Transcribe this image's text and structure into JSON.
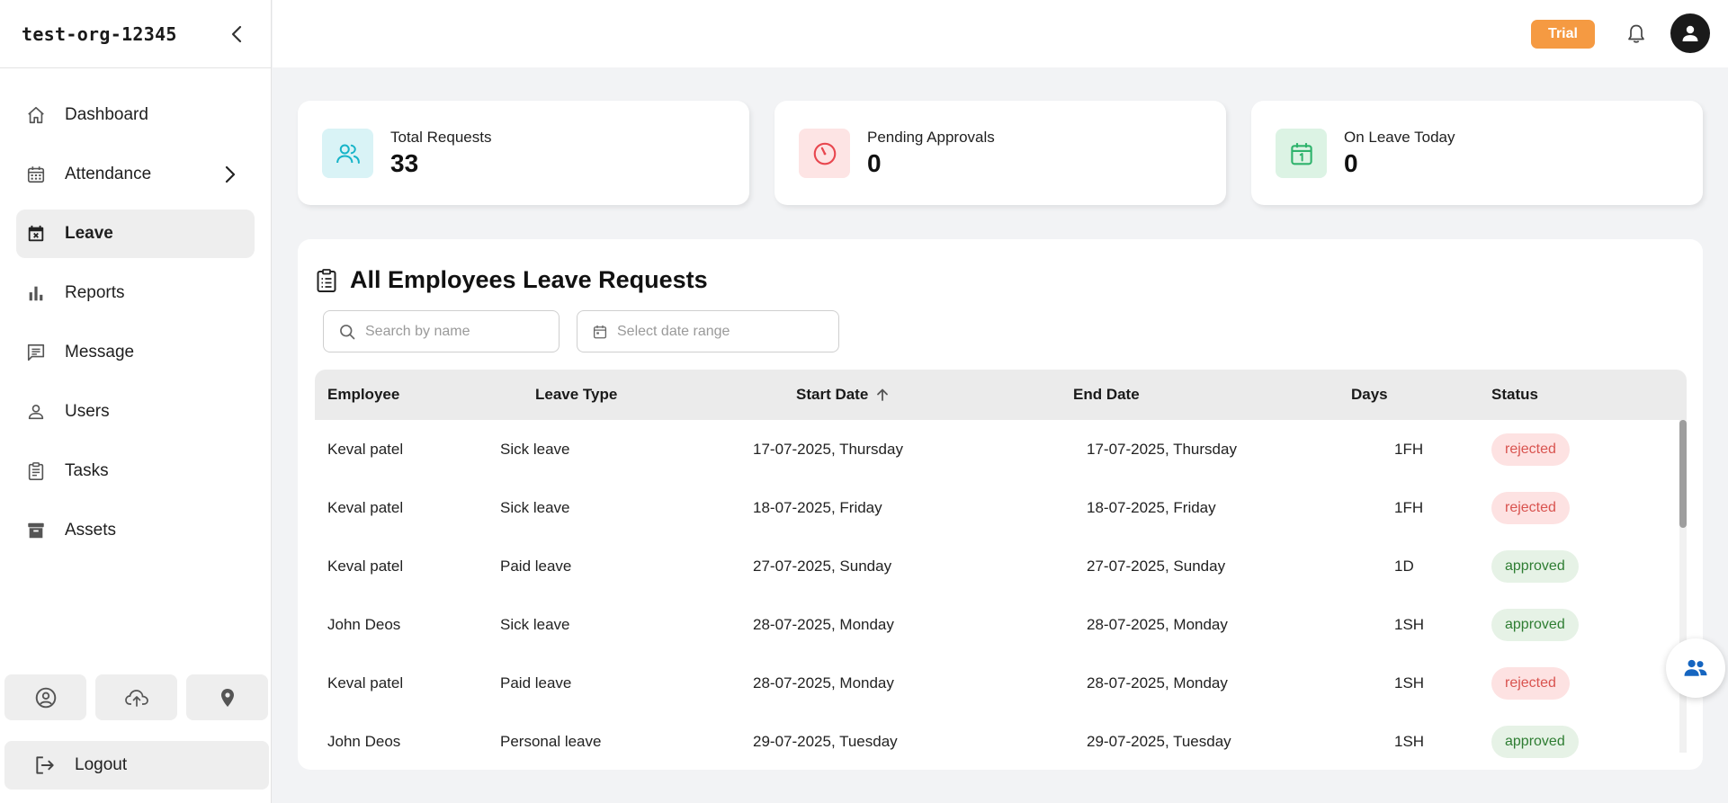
{
  "org": {
    "name": "test-org-12345"
  },
  "nav": [
    {
      "label": "Dashboard"
    },
    {
      "label": "Attendance"
    },
    {
      "label": "Leave"
    },
    {
      "label": "Reports"
    },
    {
      "label": "Message"
    },
    {
      "label": "Users"
    },
    {
      "label": "Tasks"
    },
    {
      "label": "Assets"
    }
  ],
  "sidebar_footer": {
    "logout_label": "Logout"
  },
  "topbar": {
    "trial_label": "Trial"
  },
  "stats": [
    {
      "label": "Total Requests",
      "value": "33",
      "color": "#16b4c8",
      "bg": "#d9f3f6"
    },
    {
      "label": "Pending Approvals",
      "value": "0",
      "color": "#e8474f",
      "bg": "#fde4e4"
    },
    {
      "label": "On Leave Today",
      "value": "0",
      "color": "#2fb36c",
      "bg": "#dcf3e4"
    }
  ],
  "panel": {
    "title": "All Employees Leave Requests",
    "search_placeholder": "Search by name",
    "date_placeholder": "Select date range"
  },
  "table": {
    "columns": [
      "Employee",
      "Leave Type",
      "Start Date",
      "End Date",
      "Days",
      "Status"
    ],
    "rows": [
      {
        "employee": "Keval patel",
        "type": "Sick leave",
        "start": "17-07-2025, Thursday",
        "end": "17-07-2025, Thursday",
        "days": "1FH",
        "status": "rejected"
      },
      {
        "employee": "Keval patel",
        "type": "Sick leave",
        "start": "18-07-2025, Friday",
        "end": "18-07-2025, Friday",
        "days": "1FH",
        "status": "rejected"
      },
      {
        "employee": "Keval patel",
        "type": "Paid leave",
        "start": "27-07-2025, Sunday",
        "end": "27-07-2025, Sunday",
        "days": "1D",
        "status": "approved"
      },
      {
        "employee": "John Deos",
        "type": "Sick leave",
        "start": "28-07-2025, Monday",
        "end": "28-07-2025, Monday",
        "days": "1SH",
        "status": "approved"
      },
      {
        "employee": "Keval patel",
        "type": "Paid leave",
        "start": "28-07-2025, Monday",
        "end": "28-07-2025, Monday",
        "days": "1SH",
        "status": "rejected"
      },
      {
        "employee": "John Deos",
        "type": "Personal leave",
        "start": "29-07-2025, Tuesday",
        "end": "29-07-2025, Tuesday",
        "days": "1SH",
        "status": "approved"
      }
    ]
  },
  "colors": {
    "trial": "#f59a42",
    "fab_icon": "#1565c0",
    "rejected": "#d9534f",
    "approved": "#2e7d32"
  }
}
